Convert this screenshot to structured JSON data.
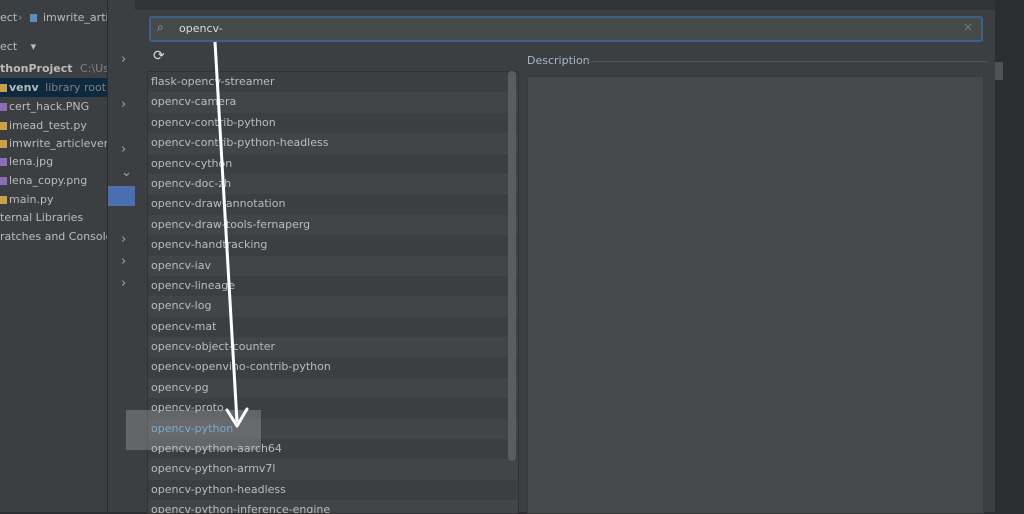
{
  "project_panel": {
    "breadcrumb_project": "ect",
    "breadcrumb_file": "imwrite_artic",
    "view_label": "ect",
    "root_name": "thonProject",
    "root_path": "C:\\Users",
    "items": [
      {
        "label": "venv",
        "suffix": "library root",
        "selected": true
      },
      {
        "label": "cert_hack.PNG"
      },
      {
        "label": "imead_test.py"
      },
      {
        "label": "imwrite_articleversio"
      },
      {
        "label": "lena.jpg"
      },
      {
        "label": "lena_copy.png"
      },
      {
        "label": "main.py"
      },
      {
        "label": "ternal Libraries"
      },
      {
        "label": "ratches and Consoles"
      }
    ]
  },
  "search": {
    "value": "opencv-"
  },
  "packages": [
    "flask-opencv-streamer",
    "opencv-camera",
    "opencv-contrib-python",
    "opencv-contrib-python-headless",
    "opencv-cython",
    "opencv-doc-zh",
    "opencv-draw-annotation",
    "opencv-draw-tools-fernaperg",
    "opencv-handtracking",
    "opencv-iav",
    "opencv-lineage",
    "opencv-log",
    "opencv-mat",
    "opencv-object-counter",
    "opencv-openvino-contrib-python",
    "opencv-pg",
    "opencv-proto",
    "opencv-python",
    "opencv-python-aarch64",
    "opencv-python-armv7l",
    "opencv-python-headless",
    "opencv-python-inference-engine"
  ],
  "highlighted_package": "opencv-python",
  "description": {
    "title": "Description"
  },
  "colors": {
    "accent": "#3d6185",
    "highlight_text": "#5e9cd4",
    "arrow": "#ffffff"
  }
}
